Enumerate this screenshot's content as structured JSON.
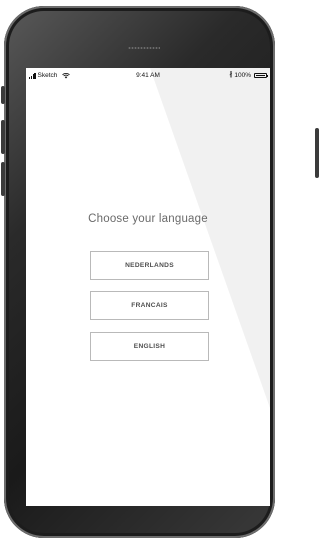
{
  "status_bar": {
    "carrier": "Sketch",
    "time": "9:41 AM",
    "bluetooth_icon": "bluetooth-icon",
    "battery": "100%"
  },
  "language_screen": {
    "prompt": "Choose your language",
    "options": [
      {
        "label": "NEDERLANDS"
      },
      {
        "label": "FRANCAIS"
      },
      {
        "label": "ENGLISH"
      }
    ]
  }
}
